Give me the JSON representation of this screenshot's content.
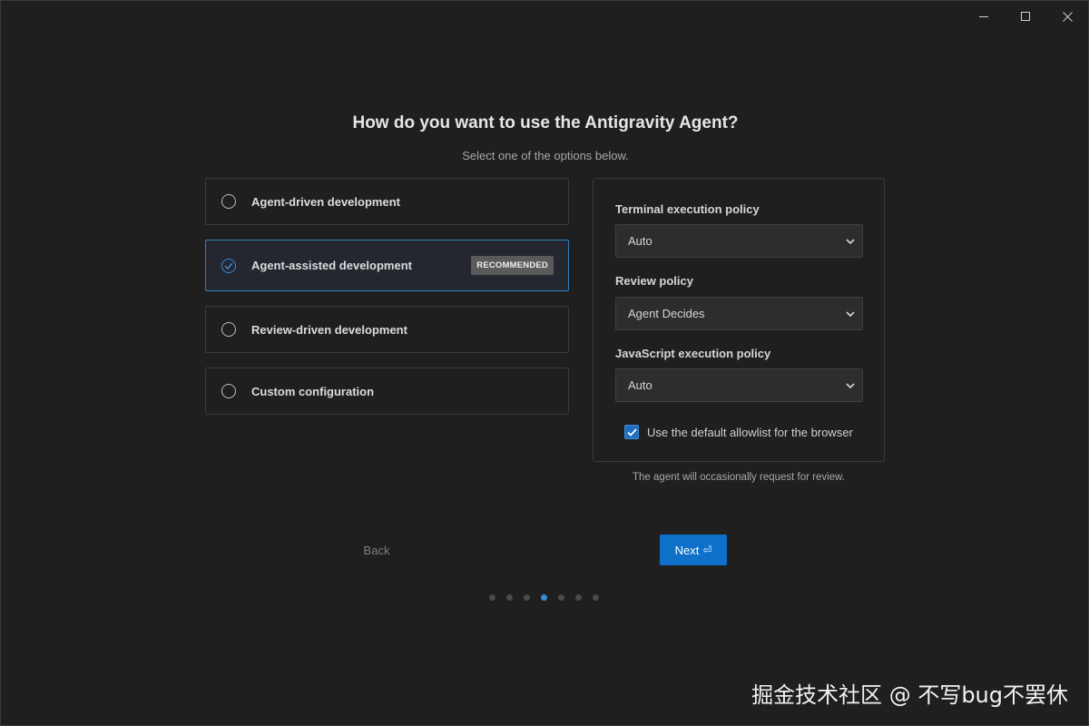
{
  "window_controls": {
    "minimize": "─",
    "maximize": "☐",
    "close": "✕"
  },
  "header": {
    "title": "How do you want to use the Antigravity Agent?",
    "subtitle": "Select one of the options below."
  },
  "options": [
    {
      "label": "Agent-driven development",
      "selected": false
    },
    {
      "label": "Agent-assisted development",
      "selected": true,
      "badge": "RECOMMENDED"
    },
    {
      "label": "Review-driven development",
      "selected": false
    },
    {
      "label": "Custom configuration",
      "selected": false
    }
  ],
  "policies": {
    "terminal": {
      "label": "Terminal execution policy",
      "value": "Auto"
    },
    "review": {
      "label": "Review policy",
      "value": "Agent Decides"
    },
    "javascript": {
      "label": "JavaScript execution policy",
      "value": "Auto"
    },
    "allowlist": {
      "label": "Use the default allowlist for the browser",
      "checked": true
    }
  },
  "note": "The agent will occasionally request for review.",
  "nav": {
    "back_label": "Back",
    "next_label": "Next",
    "next_key_hint": "⏎",
    "steps_total": 7,
    "current_step": 4
  },
  "watermark": "掘金技术社区 @ 不写bug不罢休",
  "colors": {
    "background": "#1f1f1f",
    "accent": "#0e70c8",
    "selected_border": "#2f7fc1",
    "badge": "#5a5a5a"
  }
}
